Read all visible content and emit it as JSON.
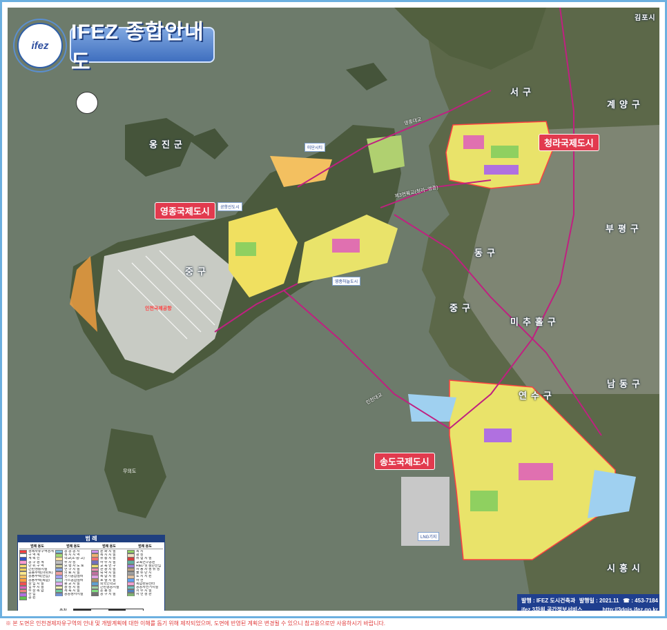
{
  "header": {
    "logo_text": "ifez",
    "title": "IFEZ 종합안내도"
  },
  "cities": {
    "yeongjong": "영종국제도시",
    "cheongna": "청라국제도시",
    "songdo": "송도국제도시"
  },
  "districts": {
    "ongjin": "옹진군",
    "seogu": "서구",
    "gyeyang": "계양구",
    "bupyeong": "부평구",
    "donggu": "동구",
    "junggu_yeongjong": "중구",
    "junggu_incheon": "중구",
    "michuhol": "미추홀구",
    "namdong": "남동구",
    "yeonsu": "연수구",
    "siheung": "시흥시",
    "gimpo": "김포시"
  },
  "places": {
    "airport": "인천국제공항",
    "mooeui": "무의도",
    "lng": "LNG기지",
    "yeongjong_airport_city": "공항신도시",
    "yeongjong_haneul": "영종하늘도시",
    "misc_1": "미단시티",
    "misc_2": "중산동"
  },
  "bridges": {
    "incheon_bridge": "인천대교",
    "yeongjong_bridge": "영종대교",
    "third_bridge": "제3연륙교(청라~영종)"
  },
  "legend": {
    "title": "범 례",
    "col_headers": [
      "범례",
      "용도"
    ],
    "col1": [
      {
        "label": "경제자유구역경계",
        "color": "#ff3b3b"
      },
      {
        "label": "구 역 계",
        "color": "#ffffff"
      },
      {
        "label": "계 획 선",
        "color": "#3050c0"
      },
      {
        "label": "공 구 경 계",
        "color": "#ff9ad0"
      },
      {
        "label": "단 위 구 역",
        "color": "#ffe070"
      },
      {
        "label": "근린생활시설",
        "color": "#f2d060"
      },
      {
        "label": "공동주택(아파트)",
        "color": "#ffe98a"
      },
      {
        "label": "공동주택(연립)",
        "color": "#f4c060"
      },
      {
        "label": "공동주택(복합)",
        "color": "#ff9f40"
      },
      {
        "label": "상 업 시 설",
        "color": "#f05050"
      },
      {
        "label": "업 무 시 설",
        "color": "#e060c0"
      },
      {
        "label": "주 상 복 합",
        "color": "#f08080"
      },
      {
        "label": "산 업",
        "color": "#b070e0"
      },
      {
        "label": "공 원",
        "color": "#60c050"
      }
    ],
    "col2": [
      {
        "label": "공 공 공 지",
        "color": "#80c0e0"
      },
      {
        "label": "녹 지 지 역",
        "color": "#a0d870"
      },
      {
        "label": "학교(초·중·고)",
        "color": "#ffe0a0"
      },
      {
        "label": "주 차 장",
        "color": "#c0c0c0"
      },
      {
        "label": "보 행 자 도 로",
        "color": "#d0d0a0"
      },
      {
        "label": "연 구 시 설",
        "color": "#90b0f0"
      },
      {
        "label": "의 료 시 설",
        "color": "#f0a0a0"
      },
      {
        "label": "전기공급설비",
        "color": "#a0a0f0"
      },
      {
        "label": "가스공급설비",
        "color": "#b0e0e0"
      },
      {
        "label": "종 교 시 설",
        "color": "#e0b0f0"
      },
      {
        "label": "광 장 시 설",
        "color": "#f0f0b0"
      },
      {
        "label": "체 육 시 설",
        "color": "#70d0a0"
      },
      {
        "label": "공공청사시설",
        "color": "#7090d0"
      }
    ],
    "col3": [
      {
        "label": "문 화 시 설",
        "color": "#d090f0"
      },
      {
        "label": "복 지 시 설",
        "color": "#f0b070"
      },
      {
        "label": "유 통 시 설",
        "color": "#f07070"
      },
      {
        "label": "하 수 시 설",
        "color": "#7070c0"
      },
      {
        "label": "교 육 연 구",
        "color": "#f0e070"
      },
      {
        "label": "관 광 시 설",
        "color": "#f090b0"
      },
      {
        "label": "숙 박 시 설",
        "color": "#c070a0"
      },
      {
        "label": "복 합 시 설",
        "color": "#e0a0e0"
      },
      {
        "label": "호 텔 시 설",
        "color": "#b09060"
      },
      {
        "label": "외국인학교",
        "color": "#60a0d0"
      },
      {
        "label": "근린공공시설",
        "color": "#a0d0a0"
      },
      {
        "label": "운 동 장",
        "color": "#80e080"
      },
      {
        "label": "공 구 시 설",
        "color": "#707070"
      }
    ],
    "col4": [
      {
        "label": "녹 지",
        "color": "#90d060"
      },
      {
        "label": "광 장",
        "color": "#f0e0c0"
      },
      {
        "label": "위 험 시 설",
        "color": "#d04040"
      },
      {
        "label": "교육연구공원",
        "color": "#60b0a0"
      },
      {
        "label": "R&D 및 첨단산업",
        "color": "#a080e0"
      },
      {
        "label": "자 동 차 정 류 장",
        "color": "#c0a080"
      },
      {
        "label": "물 류 단 지",
        "color": "#a0a0a0"
      },
      {
        "label": "도 시 지 원",
        "color": "#e0c0a0"
      },
      {
        "label": "하 천",
        "color": "#60a0f0"
      },
      {
        "label": "복합환승센터",
        "color": "#f0a0d0"
      },
      {
        "label": "공공자전거시설",
        "color": "#70c0c0"
      },
      {
        "label": "저 수 시 설",
        "color": "#5080c0"
      },
      {
        "label": "자 연 경 관",
        "color": "#80b070"
      }
    ],
    "scale_label": "축척",
    "scale_ticks": [
      "0",
      "1.5km",
      "3km"
    ]
  },
  "info": {
    "publisher": "발행 : IFEZ 도시건축과",
    "date": "발행일 : 2021.11",
    "phone": "☎ : 453-7184",
    "service": "ifez 3차원 공간정보서비스",
    "url": "http://3dgis.ifez.go.kr"
  },
  "notice": "※ 본 도면은 인천경제자유구역의 안내 및 개발계획에 대한 이해를 돕기 위해 제작되었으며, 도면에 반영된 계획은 변경될 수 있으니 참고용으로만 사용하시기 바랍니다.",
  "colors": {
    "sea": "#6f7c6c",
    "land": "#5a6a48",
    "city_label": "#e23a4e",
    "banner": "#3f6fbf",
    "road": "#c02080"
  }
}
